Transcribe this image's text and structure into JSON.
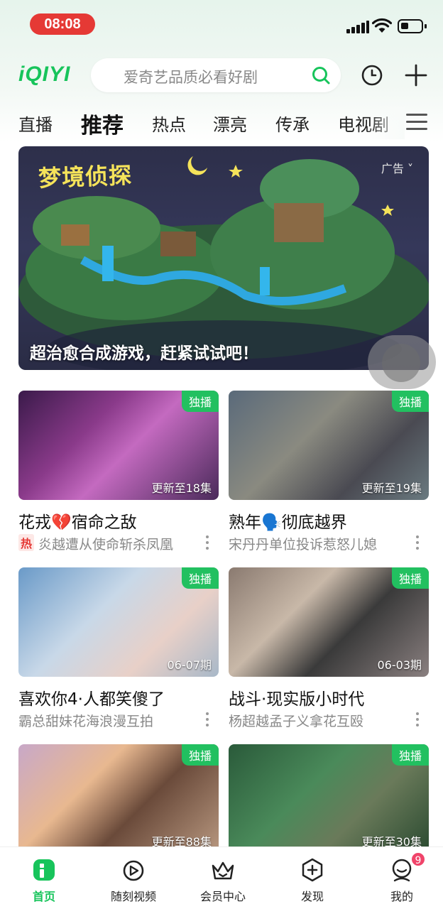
{
  "status_bar": {
    "time": "08:08"
  },
  "header": {
    "logo": "iQIYI",
    "search_placeholder": "爱奇艺品质必看好剧"
  },
  "tabs": [
    "直播",
    "推荐",
    "热点",
    "漂亮",
    "传承",
    "电视剧"
  ],
  "active_tab": "推荐",
  "banner": {
    "title": "梦境侦探",
    "ad_label": "广告 ˅",
    "caption": "超治愈合成游戏，赶紧试试吧！"
  },
  "cards": [
    {
      "title": "花戎💔宿命之敌",
      "subtitle": "炎越遭从使命斩杀凤凰",
      "hot_label": "热",
      "badge": "独播",
      "episode": "更新至18集"
    },
    {
      "title": "熟年🗣️彻底越界",
      "subtitle": "宋丹丹单位投诉惹怒儿媳",
      "badge": "独播",
      "episode": "更新至19集"
    },
    {
      "title": "喜欢你4·人都笑傻了",
      "subtitle": "霸总甜妹花海浪漫互拍",
      "badge": "独播",
      "episode": "06-07期"
    },
    {
      "title": "战斗·现实版小时代",
      "subtitle": "杨超越孟子义拿花互殴",
      "badge": "独播",
      "episode": "06-03期"
    },
    {
      "title": "",
      "subtitle": "",
      "badge": "独播",
      "episode": "更新至88集"
    },
    {
      "title": "",
      "subtitle": "",
      "badge": "独播",
      "episode": "更新至30集"
    }
  ],
  "bottom_nav": [
    {
      "label": "首页"
    },
    {
      "label": "随刻视频"
    },
    {
      "label": "会员中心"
    },
    {
      "label": "发现"
    },
    {
      "label": "我的"
    }
  ],
  "notification_count": "9",
  "colors": {
    "accent": "#17c45b",
    "badge": "#22c060",
    "time_pill": "#e53935"
  }
}
